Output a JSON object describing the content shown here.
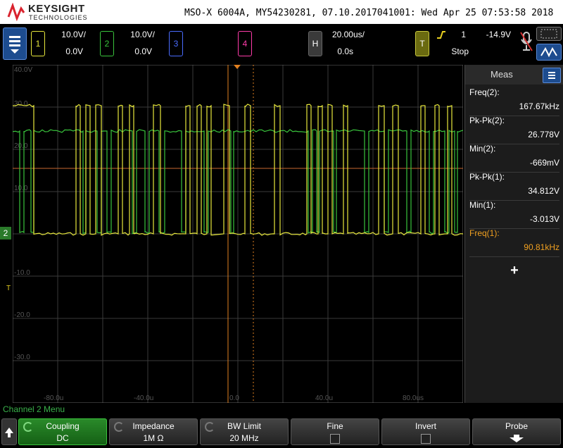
{
  "header": {
    "brand": "KEYSIGHT",
    "brand_sub": "TECHNOLOGIES",
    "title": "MSO-X 6004A, MY54230281, 07.10.2017041001: Wed Apr 25 07:53:58 2018"
  },
  "channels": [
    {
      "num": "1",
      "scale": "10.0V/",
      "offset": "0.0V",
      "color": "#e8e83c"
    },
    {
      "num": "2",
      "scale": "10.0V/",
      "offset": "0.0V",
      "color": "#39c43c"
    },
    {
      "num": "3",
      "color": "#4a6cff"
    },
    {
      "num": "4",
      "color": "#ff3caa"
    }
  ],
  "horizontal": {
    "key": "H",
    "scale": "20.00us/",
    "position": "0.0s"
  },
  "trigger": {
    "key": "T",
    "source": "1",
    "level": "-14.9V",
    "state": "Stop"
  },
  "axis": {
    "y_labels": [
      "40.0V",
      "30.0",
      "20.0",
      "10.0",
      "-10.0",
      "-20.0",
      "-30.0"
    ],
    "x_labels": [
      "-80.0u",
      "-40.0u",
      "0.0",
      "40.0u",
      "80.0us"
    ],
    "ch2_marker": "2",
    "trigger_marker": "T"
  },
  "meas": {
    "title": "Meas",
    "items": [
      {
        "label": "Freq(2):",
        "value": "167.67kHz",
        "color": "#ffffff"
      },
      {
        "label": "Pk-Pk(2):",
        "value": "26.778V",
        "color": "#ffffff"
      },
      {
        "label": "Min(2):",
        "value": "-669mV",
        "color": "#ffffff"
      },
      {
        "label": "Pk-Pk(1):",
        "value": "34.812V",
        "color": "#ffffff"
      },
      {
        "label": "Min(1):",
        "value": "-3.013V",
        "color": "#ffffff"
      },
      {
        "label": "Freq(1):",
        "value": "90.81kHz",
        "color": "#f0a020"
      }
    ],
    "add_label": "+"
  },
  "status": "Channel 2 Menu",
  "softkeys": [
    {
      "label": "Coupling",
      "value": "DC"
    },
    {
      "label": "Impedance",
      "value": "1M Ω"
    },
    {
      "label": "BW Limit",
      "value": "20 MHz"
    },
    {
      "label": "Fine",
      "value": ""
    },
    {
      "label": "Invert",
      "value": ""
    },
    {
      "label": "Probe",
      "value": ""
    }
  ]
}
